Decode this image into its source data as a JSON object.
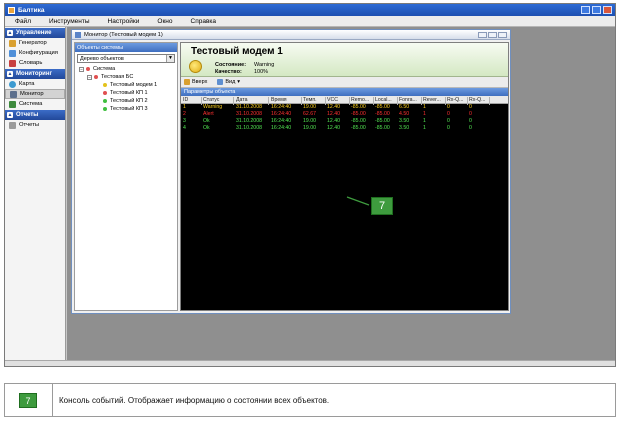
{
  "app": {
    "title": "Балтика"
  },
  "menu": [
    "Файл",
    "Инструменты",
    "Настройки",
    "Окно",
    "Справка"
  ],
  "nav": {
    "groups": [
      {
        "label": "Управление",
        "items": [
          "Генератор",
          "Конфигурация",
          "Словарь"
        ]
      },
      {
        "label": "Мониторинг",
        "items": [
          "Карта",
          "Монитор",
          "Система"
        ]
      },
      {
        "label": "Отчеты",
        "items": [
          "Отчеты"
        ]
      }
    ]
  },
  "child": {
    "title": "Монитор (Тестовый модем 1)",
    "left_header": "Объекты системы",
    "combo_value": "Дерево объектов",
    "tree": [
      "Система",
      "Тестовая БС",
      "Тестовый модем 1",
      "Тестовый КП 1",
      "Тестовый КП 2",
      "Тестовый КП 3"
    ]
  },
  "detail": {
    "name": "Тестовый модем 1",
    "state_label": "Состояние:",
    "state_value": "Warning",
    "quality_label": "Качество:",
    "quality_value": "100%",
    "tool_up": "Вверх",
    "tool_view": "Вид",
    "params_header": "Параметры объекта",
    "columns": [
      "ID",
      "Статус",
      "Дата",
      "Время",
      "Темп.",
      "VCC",
      "Remo...",
      "Local...",
      "Fonra...",
      "Rever...",
      "Rx-Q...",
      "Rx-Q..."
    ],
    "rows": [
      [
        "1",
        "Warning",
        "31.10.2008",
        "16:24:40",
        "19.00",
        "12.40",
        "-85.00",
        "-85.00",
        "6.50",
        "1",
        "0",
        "0"
      ],
      [
        "2",
        "Alert",
        "31.10.2008",
        "16:24:40",
        "62.67",
        "12.40",
        "-85.00",
        "-85.00",
        "4.50",
        "1",
        "0",
        "0"
      ],
      [
        "3",
        "Ok",
        "31.10.2008",
        "16:24:40",
        "19.00",
        "12.40",
        "-85.00",
        "-85.00",
        "3.50",
        "1",
        "0",
        "0"
      ],
      [
        "4",
        "Ok",
        "31.10.2008",
        "16:24:40",
        "19.00",
        "12.40",
        "-85.00",
        "-85.00",
        "3.50",
        "1",
        "0",
        "0"
      ]
    ]
  },
  "callout": {
    "number": "7"
  },
  "caption": {
    "number": "7",
    "text": "Консоль событий. Отображает информацию о состоянии всех объектов."
  },
  "colors": {
    "warning": "#ffd21e",
    "alert": "#ff3030",
    "ok": "#52e552",
    "accent": "#3e9b3e"
  }
}
